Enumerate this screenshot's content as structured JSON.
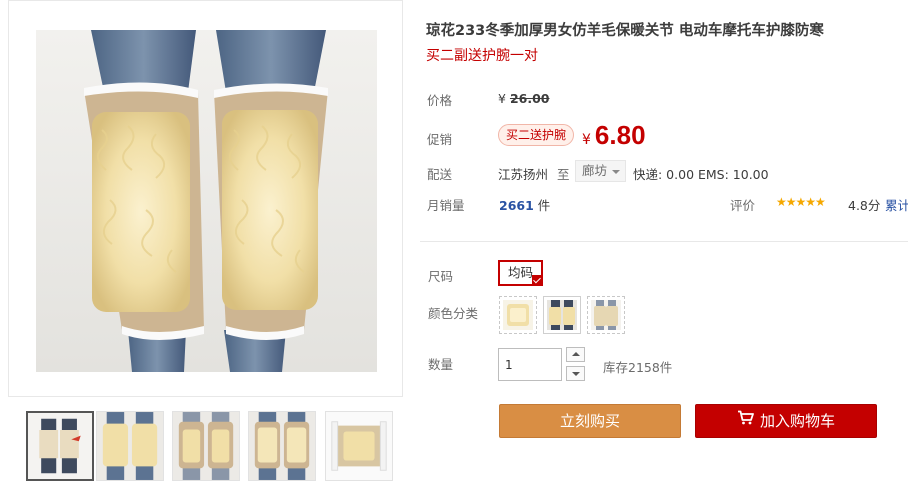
{
  "product": {
    "title": "琼花233冬季加厚男女仿羊毛保暖关节 电动车摩托车护膝防寒",
    "subtitle": "买二副送护腕一对"
  },
  "price": {
    "label": "价格",
    "currency": "¥",
    "original": "26.00"
  },
  "promotion": {
    "label": "促销",
    "tag": "买二送护腕",
    "currency": "¥",
    "price": "6.80"
  },
  "shipping": {
    "label": "配送",
    "from": "江苏扬州",
    "to_word": "至",
    "destination": "廊坊",
    "fees": "快递: 0.00 EMS: 10.00"
  },
  "sales": {
    "label": "月销量",
    "count": "2661",
    "unit": "件"
  },
  "rating": {
    "label": "评价",
    "stars": "★★★★★",
    "score": "4.8分",
    "more_link": "累计"
  },
  "options": {
    "size_label": "尺码",
    "size_value": "均码",
    "color_label": "颜色分类"
  },
  "quantity": {
    "label": "数量",
    "value": "1",
    "stock": "库存2158件"
  },
  "actions": {
    "buy_now": "立刻购买",
    "add_cart": "加入购物车"
  },
  "colors": {
    "promo_red": "#c40000",
    "buy_now_orange": "#d98e44",
    "link_blue": "#2952a3",
    "star_gold": "#f5a800"
  }
}
